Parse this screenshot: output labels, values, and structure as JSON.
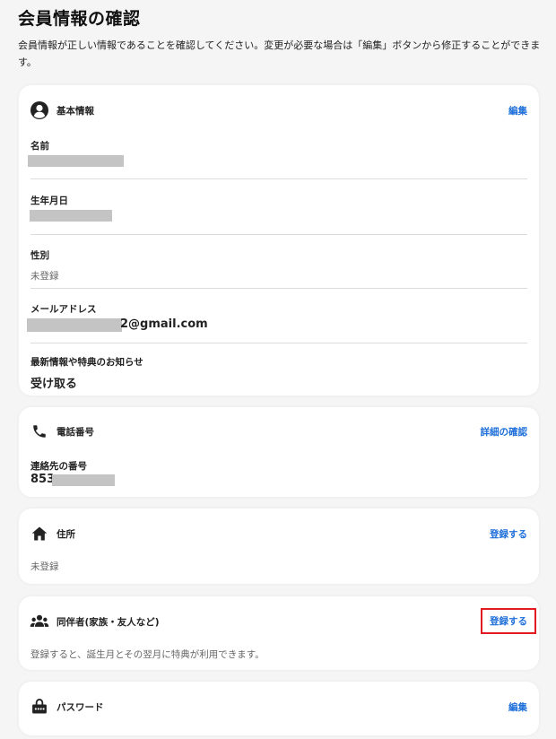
{
  "page": {
    "title": "会員情報の確認",
    "intro": "会員情報が正しい情報であることを確認してください。変更が必要な場合は「編集」ボタンから修正することができます。"
  },
  "basic": {
    "title": "基本情報",
    "action": "編集",
    "icon": "user-circle-icon",
    "fields": {
      "name_label": "名前",
      "birthday_label": "生年月日",
      "gender_label": "性別",
      "gender_value": "未登録",
      "email_label": "メールアドレス",
      "email_suffix": "2@gmail.com",
      "newsletter_label": "最新情報や特典のお知らせ",
      "newsletter_value": "受け取る"
    }
  },
  "phone": {
    "title": "電話番号",
    "action": "詳細の確認",
    "icon": "phone-icon",
    "contact_label": "連絡先の番号",
    "contact_prefix": "853"
  },
  "address": {
    "title": "住所",
    "action": "登録する",
    "icon": "home-icon",
    "value": "未登録"
  },
  "companion": {
    "title": "同伴者(家族・友人など)",
    "action": "登録する",
    "icon": "people-group-icon",
    "description": "登録すると、誕生月とその翌月に特典が利用できます。"
  },
  "password": {
    "title": "パスワード",
    "action": "編集",
    "icon": "password-lock-icon"
  },
  "colors": {
    "link": "#1e6fd9",
    "highlight_border": "#e21b22",
    "redaction": "#c4c4c4"
  }
}
